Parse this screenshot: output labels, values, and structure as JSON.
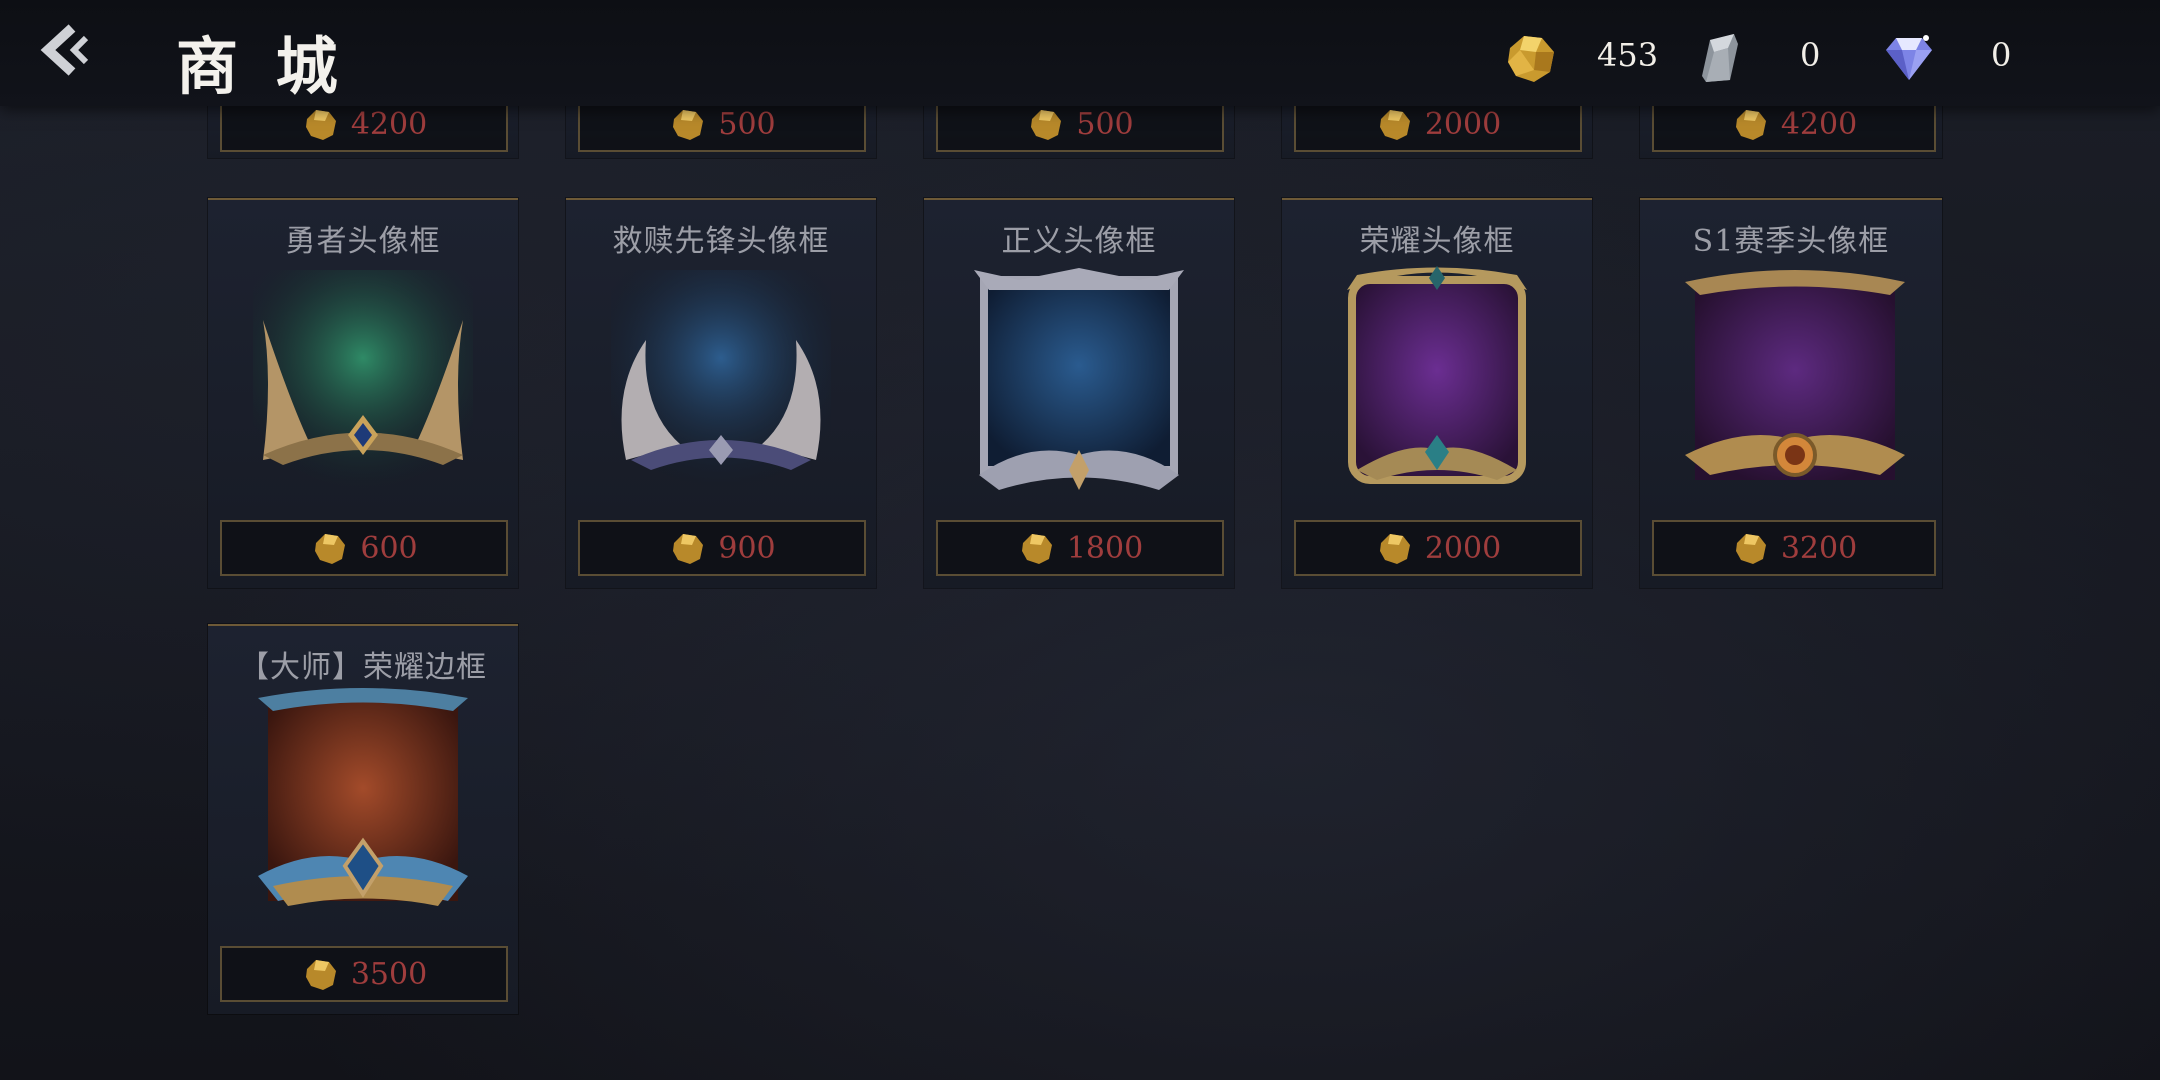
{
  "header": {
    "title": "商 城",
    "back_icon": "chevron-left-icon"
  },
  "currencies": [
    {
      "icon": "gold-ore-icon",
      "amount": "453"
    },
    {
      "icon": "silver-stone-icon",
      "amount": "0"
    },
    {
      "icon": "diamond-icon",
      "amount": "0"
    }
  ],
  "top_row_prices": [
    "4200",
    "500",
    "500",
    "2000",
    "4200"
  ],
  "items": [
    {
      "name": "勇者头像框",
      "price": "600",
      "bg": "#1d5a45"
    },
    {
      "name": "救赎先锋头像框",
      "price": "900",
      "bg": "#1c3a5e"
    },
    {
      "name": "正义头像框",
      "price": "1800",
      "bg": "#1b3c62"
    },
    {
      "name": "荣耀头像框",
      "price": "2000",
      "bg": "#4c1f66"
    },
    {
      "name": "S1赛季头像框",
      "price": "3200",
      "bg": "#421f5a"
    },
    {
      "name": "【大师】荣耀边框",
      "price": "3500",
      "bg": "#6a321e"
    }
  ],
  "colors": {
    "price_text": "#9f3d3d",
    "card_border": "#6e5a37",
    "title_text": "#f3f1ec"
  }
}
